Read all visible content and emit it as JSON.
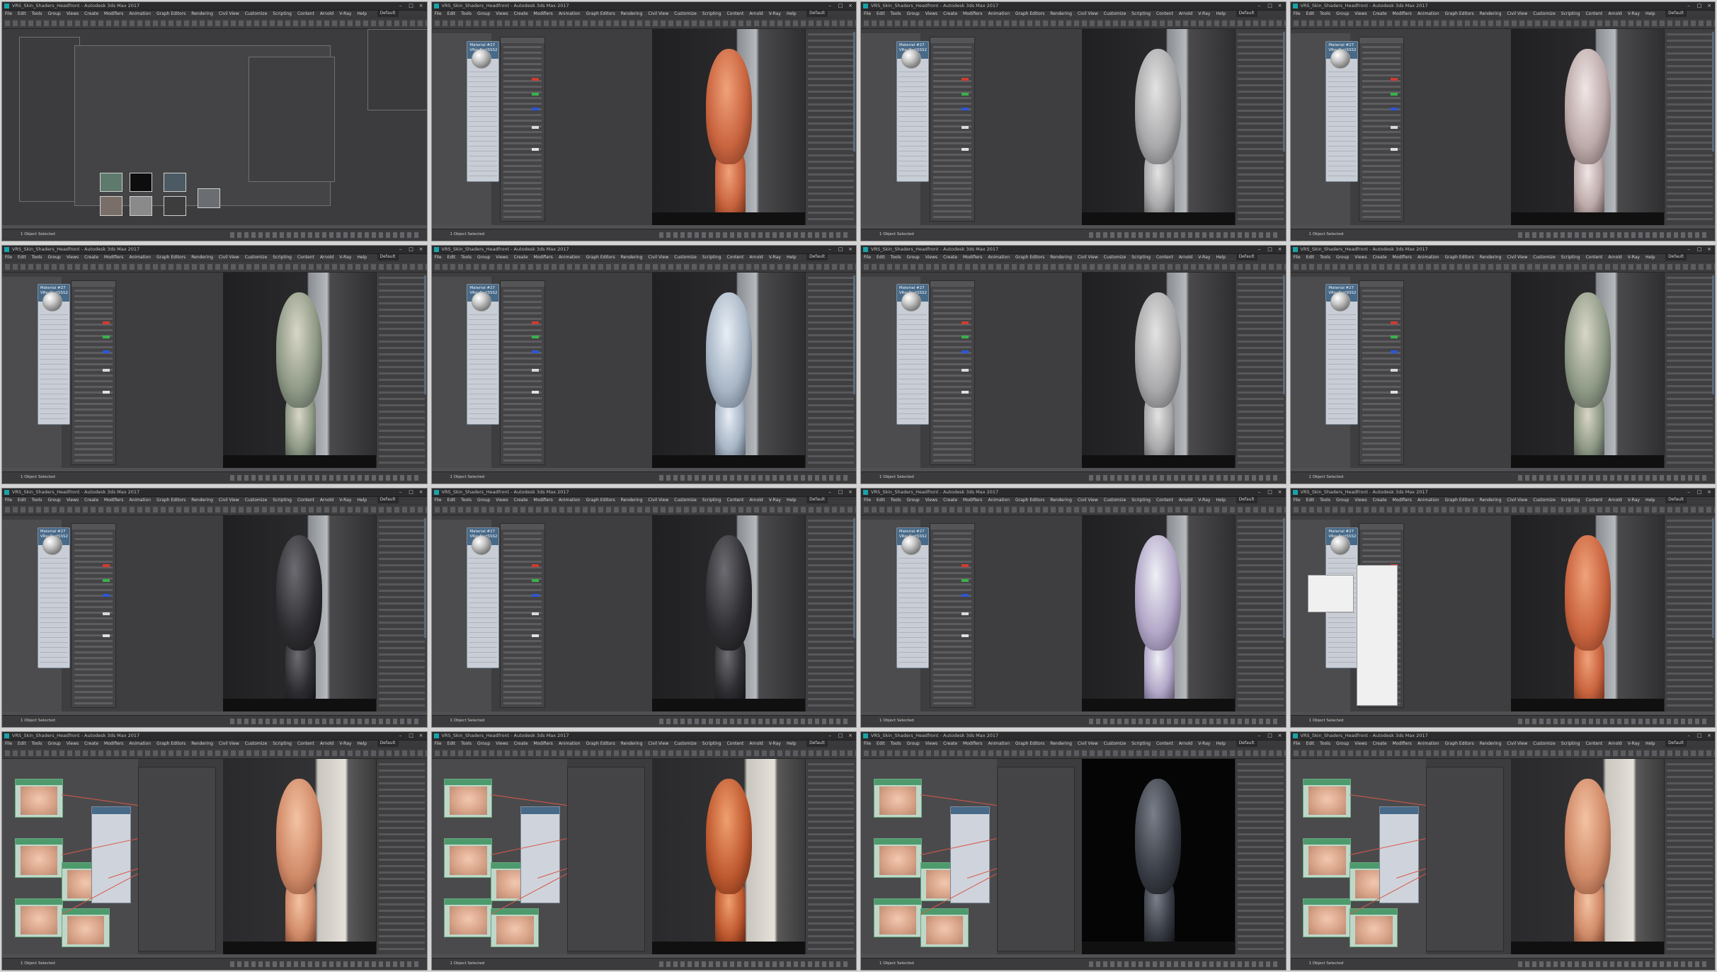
{
  "app": {
    "title": "VRS_Skin_Shaders_Headfront - Autodesk 3ds Max 2017",
    "menus": [
      "File",
      "Edit",
      "Tools",
      "Group",
      "Views",
      "Create",
      "Modifiers",
      "Animation",
      "Graph Editors",
      "Rendering",
      "Civil View",
      "Customize",
      "Scripting",
      "Content",
      "Arnold",
      "V-Ray",
      "Help"
    ],
    "workspace_label": "Default",
    "status_text": "1 Object Selected",
    "window_controls": [
      "–",
      "□",
      "×"
    ]
  },
  "material": {
    "name": "Material #27",
    "type": "VRayFastSSS2"
  },
  "frames": [
    {
      "id": 1,
      "variant": "explorer"
    },
    {
      "id": 2,
      "variant": "slate",
      "skin": "orange"
    },
    {
      "id": 3,
      "variant": "slate",
      "skin": "grey"
    },
    {
      "id": 4,
      "variant": "slate",
      "skin": "pale"
    },
    {
      "id": 5,
      "variant": "slate",
      "skin": "noise"
    },
    {
      "id": 6,
      "variant": "slate",
      "skin": "blue"
    },
    {
      "id": 7,
      "variant": "slate",
      "skin": "grey"
    },
    {
      "id": 8,
      "variant": "slate",
      "skin": "noise"
    },
    {
      "id": 9,
      "variant": "slate",
      "skin": "dark"
    },
    {
      "id": 10,
      "variant": "slate",
      "skin": "dark"
    },
    {
      "id": 11,
      "variant": "slate",
      "skin": "violet"
    },
    {
      "id": 12,
      "variant": "menu",
      "skin": "orange"
    },
    {
      "id": 13,
      "variant": "nodes",
      "skin": "skin"
    },
    {
      "id": 14,
      "variant": "nodes",
      "skin": "speckle"
    },
    {
      "id": 15,
      "variant": "nodes",
      "skin": "darkbg"
    },
    {
      "id": 16,
      "variant": "nodes",
      "skin": "skin"
    }
  ],
  "colors": {
    "ui_dark": "#333335",
    "panel": "#444446",
    "node_header": "#486a89",
    "texture_node": "#4d9b6d",
    "wire": "#d8584a",
    "accent_red": "#d23b2f",
    "accent_green": "#39b34a",
    "accent_blue": "#2d55d6"
  },
  "icons": [
    "app-icon",
    "minimize-icon",
    "maximize-icon",
    "close-icon",
    "material-sphere-icon"
  ]
}
